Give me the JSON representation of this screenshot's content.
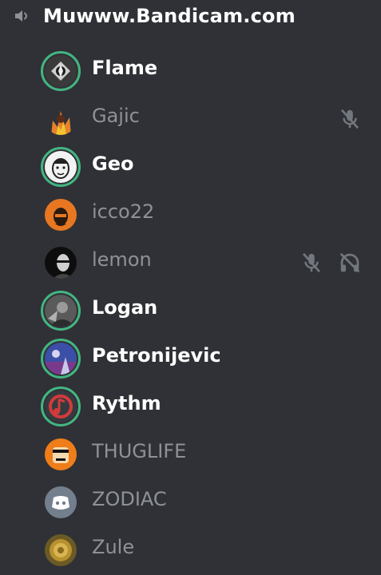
{
  "channel": {
    "name": "Muwww.Bandicam.com",
    "watermark": ""
  },
  "members": [
    {
      "name": "Flame",
      "speaking": true,
      "avatar": "dark-logo-avatar",
      "muted": false,
      "deafened": false
    },
    {
      "name": "Gajic",
      "speaking": false,
      "avatar": "fire-avatar",
      "muted": true,
      "deafened": false
    },
    {
      "name": "Geo",
      "speaking": true,
      "avatar": "sketch-face-avatar",
      "muted": false,
      "deafened": false
    },
    {
      "name": "icco22",
      "speaking": false,
      "avatar": "orange-portrait-avatar",
      "muted": false,
      "deafened": false
    },
    {
      "name": "lemon",
      "speaking": false,
      "avatar": "dark-portrait-avatar",
      "muted": true,
      "deafened": true
    },
    {
      "name": "Logan",
      "speaking": true,
      "avatar": "gray-photo-avatar",
      "muted": false,
      "deafened": false
    },
    {
      "name": "Petronijevic",
      "speaking": true,
      "avatar": "blue-scene-avatar",
      "muted": false,
      "deafened": false
    },
    {
      "name": "Rythm",
      "speaking": true,
      "avatar": "red-note-avatar",
      "muted": false,
      "deafened": false
    },
    {
      "name": "THUGLIFE",
      "speaking": false,
      "avatar": "orange-thug-avatar",
      "muted": false,
      "deafened": false
    },
    {
      "name": "ZODIAC",
      "speaking": false,
      "avatar": "discord-default-avatar",
      "muted": false,
      "deafened": false
    },
    {
      "name": "Zule",
      "speaking": false,
      "avatar": "gold-coin-avatar",
      "muted": false,
      "deafened": false
    }
  ],
  "colors": {
    "background": "#2f3136",
    "speaking_ring": "#43b581",
    "active_text": "#ffffff",
    "idle_text": "#8e9297",
    "icon_gray": "#72767d"
  }
}
